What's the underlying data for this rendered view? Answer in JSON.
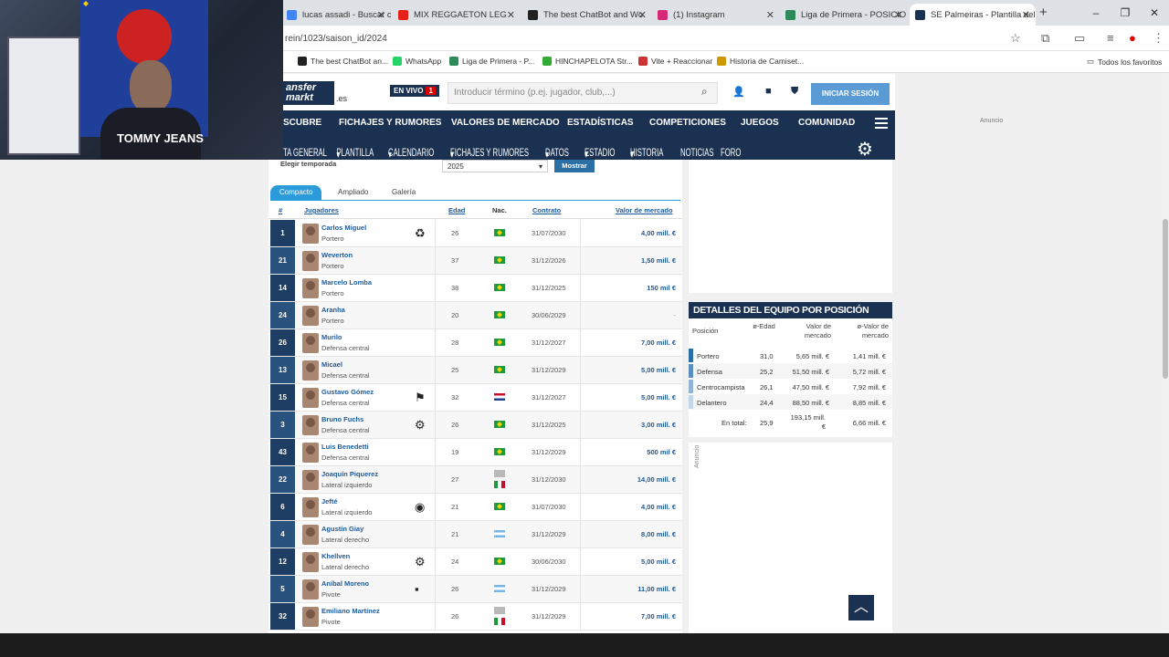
{
  "browser": {
    "tabs": [
      {
        "title": "lucas assadi - Buscar con G",
        "color": "#4285f4"
      },
      {
        "title": "MIX REGGAETON LEG",
        "color": "#e62117"
      },
      {
        "title": "The best ChatBot and Wo",
        "color": "#222222"
      },
      {
        "title": "(1) Instagram",
        "color": "#d62976"
      },
      {
        "title": "Liga de Primera - POSICIO",
        "color": "#2e8b57"
      },
      {
        "title": "SE Palmeiras - Plantilla del",
        "color": "#1a3151"
      }
    ],
    "url": "rein/1023/saison_id/2024",
    "bookmarks": [
      "The best ChatBot an...",
      "WhatsApp",
      "Liga de Primera - P...",
      "HINCHAPELOTA Str...",
      "Vite + Reaccionar",
      "Historia de Camiset..."
    ],
    "all_bookmarks": "Todos los favoritos"
  },
  "webcam": {
    "shirt_text": "TOMMY JEANS"
  },
  "header": {
    "logo": "ansfer markt",
    "logo_suffix": ".es",
    "live": "EN VIVO",
    "live_count": "1",
    "search_placeholder": "Introducir término (p.ej. jugador, club,...)",
    "login": "INICIAR SESIÓN"
  },
  "nav1": [
    "SCUBRE",
    "FICHAJES Y RUMORES",
    "VALORES DE MERCADO",
    "ESTADÍSTICAS",
    "COMPETICIONES",
    "JUEGOS",
    "COMUNIDAD"
  ],
  "nav2": [
    "TA GENERAL",
    "PLANTILLA",
    "CALENDARIO",
    "FICHAJES Y RUMORES",
    "DATOS",
    "ESTADIO",
    "HISTORIA",
    "NOTICIAS",
    "FORO"
  ],
  "ad_label": "Anuncio",
  "season": {
    "label": "Elegir temporada",
    "value": "2025",
    "button": "Mostrar"
  },
  "view_tabs": [
    "Compacto",
    "Ampliado",
    "Galería"
  ],
  "columns": [
    "#",
    "Jugadores",
    "Edad",
    "Nac.",
    "Contrato",
    "Valor de mercado"
  ],
  "players": [
    {
      "num": "1",
      "name": "Carlos Miguel",
      "pos": "Portero",
      "age": "26",
      "nat": "br",
      "contract": "31/07/2030",
      "value": "4,00 mill. €"
    },
    {
      "num": "21",
      "name": "Weverton",
      "pos": "Portero",
      "age": "37",
      "nat": "br",
      "contract": "31/12/2026",
      "value": "1,50 mill. €"
    },
    {
      "num": "14",
      "name": "Marcelo Lomba",
      "pos": "Portero",
      "age": "38",
      "nat": "br",
      "contract": "31/12/2025",
      "value": "150 mil €"
    },
    {
      "num": "24",
      "name": "Aranha",
      "pos": "Portero",
      "age": "20",
      "nat": "br",
      "contract": "30/06/2029",
      "value": "-"
    },
    {
      "num": "26",
      "name": "Murilo",
      "pos": "Defensa central",
      "age": "28",
      "nat": "br",
      "contract": "31/12/2027",
      "value": "7,00 mill. €"
    },
    {
      "num": "13",
      "name": "Micael",
      "pos": "Defensa central",
      "age": "25",
      "nat": "br",
      "contract": "31/12/2029",
      "value": "5,00 mill. €"
    },
    {
      "num": "15",
      "name": "Gustavo Gómez",
      "pos": "Defensa central",
      "age": "32",
      "nat": "nl",
      "contract": "31/12/2027",
      "value": "5,00 mill. €"
    },
    {
      "num": "3",
      "name": "Bruno Fuchs",
      "pos": "Defensa central",
      "age": "26",
      "nat": "br",
      "contract": "31/12/2025",
      "value": "3,00 mill. €"
    },
    {
      "num": "43",
      "name": "Luis Benedetti",
      "pos": "Defensa central",
      "age": "19",
      "nat": "br",
      "contract": "31/12/2029",
      "value": "500 mil €"
    },
    {
      "num": "22",
      "name": "Joaquín Piquerez",
      "pos": "Lateral izquierdo",
      "age": "27",
      "nat": "it",
      "contract": "31/12/2030",
      "value": "14,00 mill. €"
    },
    {
      "num": "6",
      "name": "Jefté",
      "pos": "Lateral izquierdo",
      "age": "21",
      "nat": "br",
      "contract": "31/07/2030",
      "value": "4,00 mill. €"
    },
    {
      "num": "4",
      "name": "Agustín Giay",
      "pos": "Lateral derecho",
      "age": "21",
      "nat": "ar",
      "contract": "31/12/2029",
      "value": "8,00 mill. €"
    },
    {
      "num": "12",
      "name": "Khellven",
      "pos": "Lateral derecho",
      "age": "24",
      "nat": "br",
      "contract": "30/06/2030",
      "value": "5,00 mill. €"
    },
    {
      "num": "5",
      "name": "Aníbal Moreno",
      "pos": "Pivote",
      "age": "26",
      "nat": "ar",
      "contract": "31/12/2029",
      "value": "11,00 mill. €"
    },
    {
      "num": "32",
      "name": "Emiliano Martínez",
      "pos": "Pivote",
      "age": "26",
      "nat": "it",
      "contract": "31/12/2029",
      "value": "7,00 mill. €"
    }
  ],
  "sidebar": {
    "title": "DETALLES DEL EQUIPO POR POSICIÓN",
    "headers": [
      "Posición",
      "ø-Edad",
      "Valor de mercado",
      "ø-Valor de mercado"
    ],
    "rows": [
      {
        "pos": "Portero",
        "age": "31,0",
        "value": "5,65 mill. €",
        "avg": "1,41 mill. €",
        "color": "#2c6fa5"
      },
      {
        "pos": "Defensa",
        "age": "25,2",
        "value": "51,50 mill. €",
        "avg": "5,72 mill. €",
        "color": "#5b8fbf"
      },
      {
        "pos": "Centrocampista",
        "age": "26,1",
        "value": "47,50 mill. €",
        "avg": "7,92 mill. €",
        "color": "#8fb4d6"
      },
      {
        "pos": "Delantero",
        "age": "24,4",
        "value": "88,50 mill. €",
        "avg": "8,85 mill. €",
        "color": "#c2d7ea"
      }
    ],
    "total_label": "En total:",
    "total_age": "25,9",
    "total_value": "193,15 mill. €",
    "total_avg": "6,66 mill. €"
  }
}
